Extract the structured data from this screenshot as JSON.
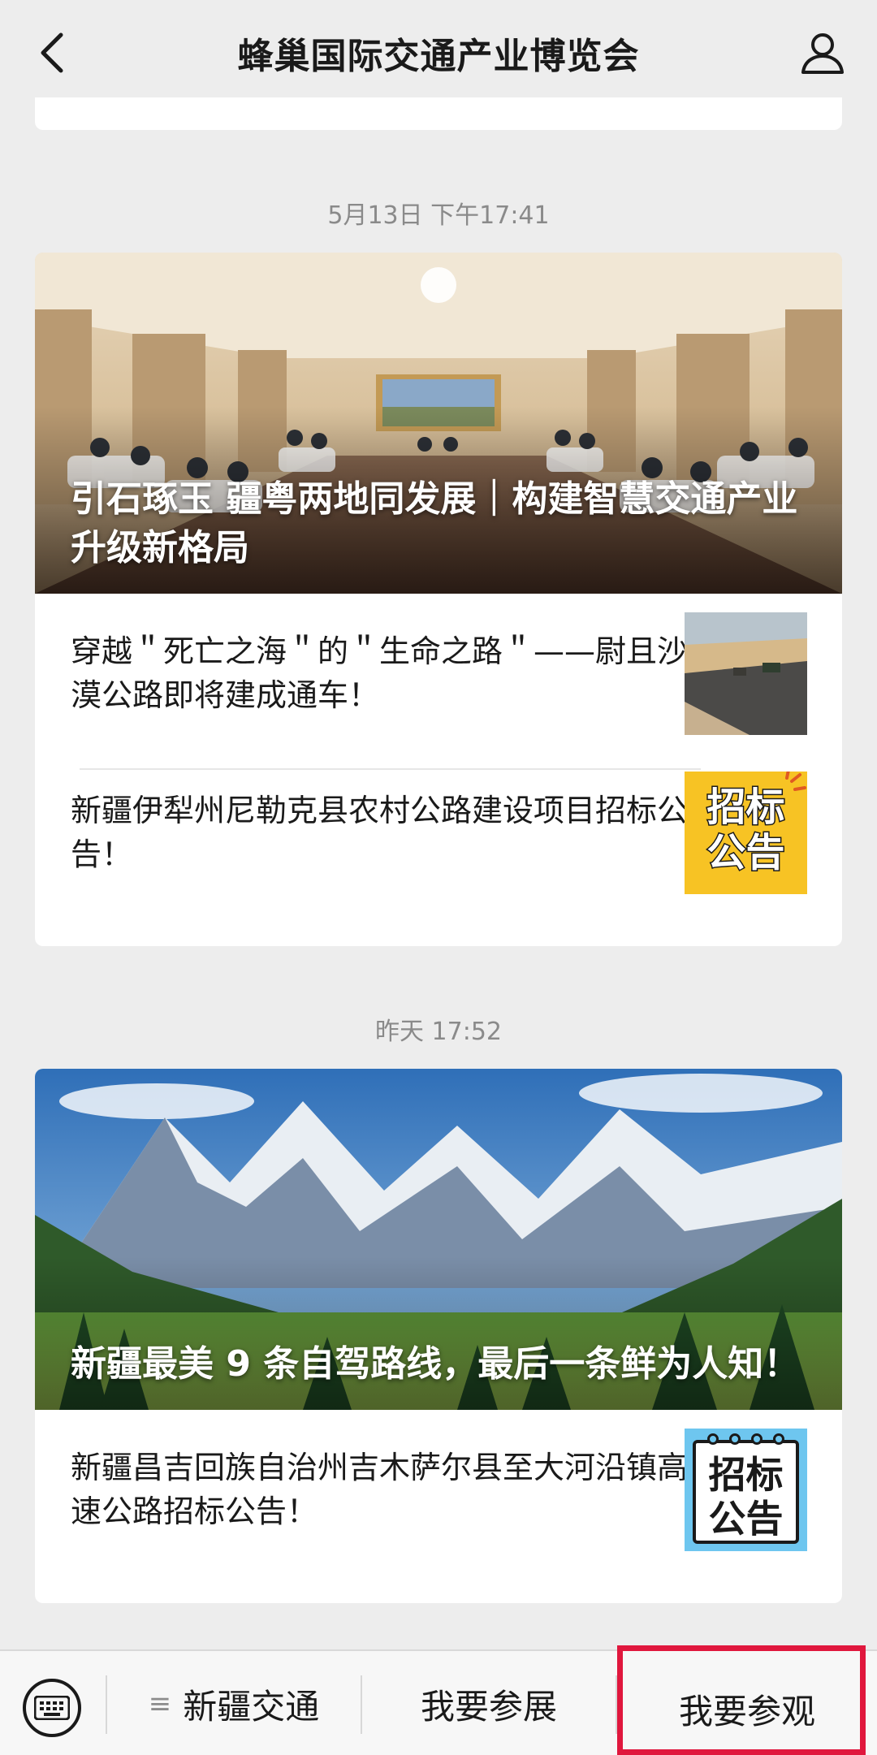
{
  "header": {
    "title": "蜂巢国际交通产业博览会",
    "back_icon": "chevron-left-icon",
    "profile_icon": "person-icon"
  },
  "groups": [
    {
      "timestamp": "5月13日 下午17:41",
      "cover_title": "引石琢玉 疆粤两地同发展｜构建智慧交通产业升级新格局",
      "items": [
        {
          "text": "穿越＂死亡之海＂的＂生命之路＂——尉且沙漠公路即将建成通车！"
        },
        {
          "text": "新疆伊犁州尼勒克县农村公路建设项目招标公告！",
          "thumb_text_1": "招标",
          "thumb_text_2": "公告"
        }
      ]
    },
    {
      "timestamp": "昨天 17:52",
      "cover_title": "新疆最美 9 条自驾路线，最后一条鲜为人知！",
      "items": [
        {
          "text": "新疆昌吉回族自治州吉木萨尔县至大河沿镇高速公路招标公告！",
          "thumb_text_1": "招标",
          "thumb_text_2": "公告"
        }
      ]
    }
  ],
  "bottom_bar": {
    "keyboard_icon": "keyboard-icon",
    "menu_icon": "≡",
    "menus": [
      "新疆交通",
      "我要参展",
      "我要参观"
    ]
  },
  "colors": {
    "background": "#ededed",
    "highlight": "#e0173d",
    "ad_yellow": "#f7c324",
    "ad_blue": "#6ec6ef"
  }
}
